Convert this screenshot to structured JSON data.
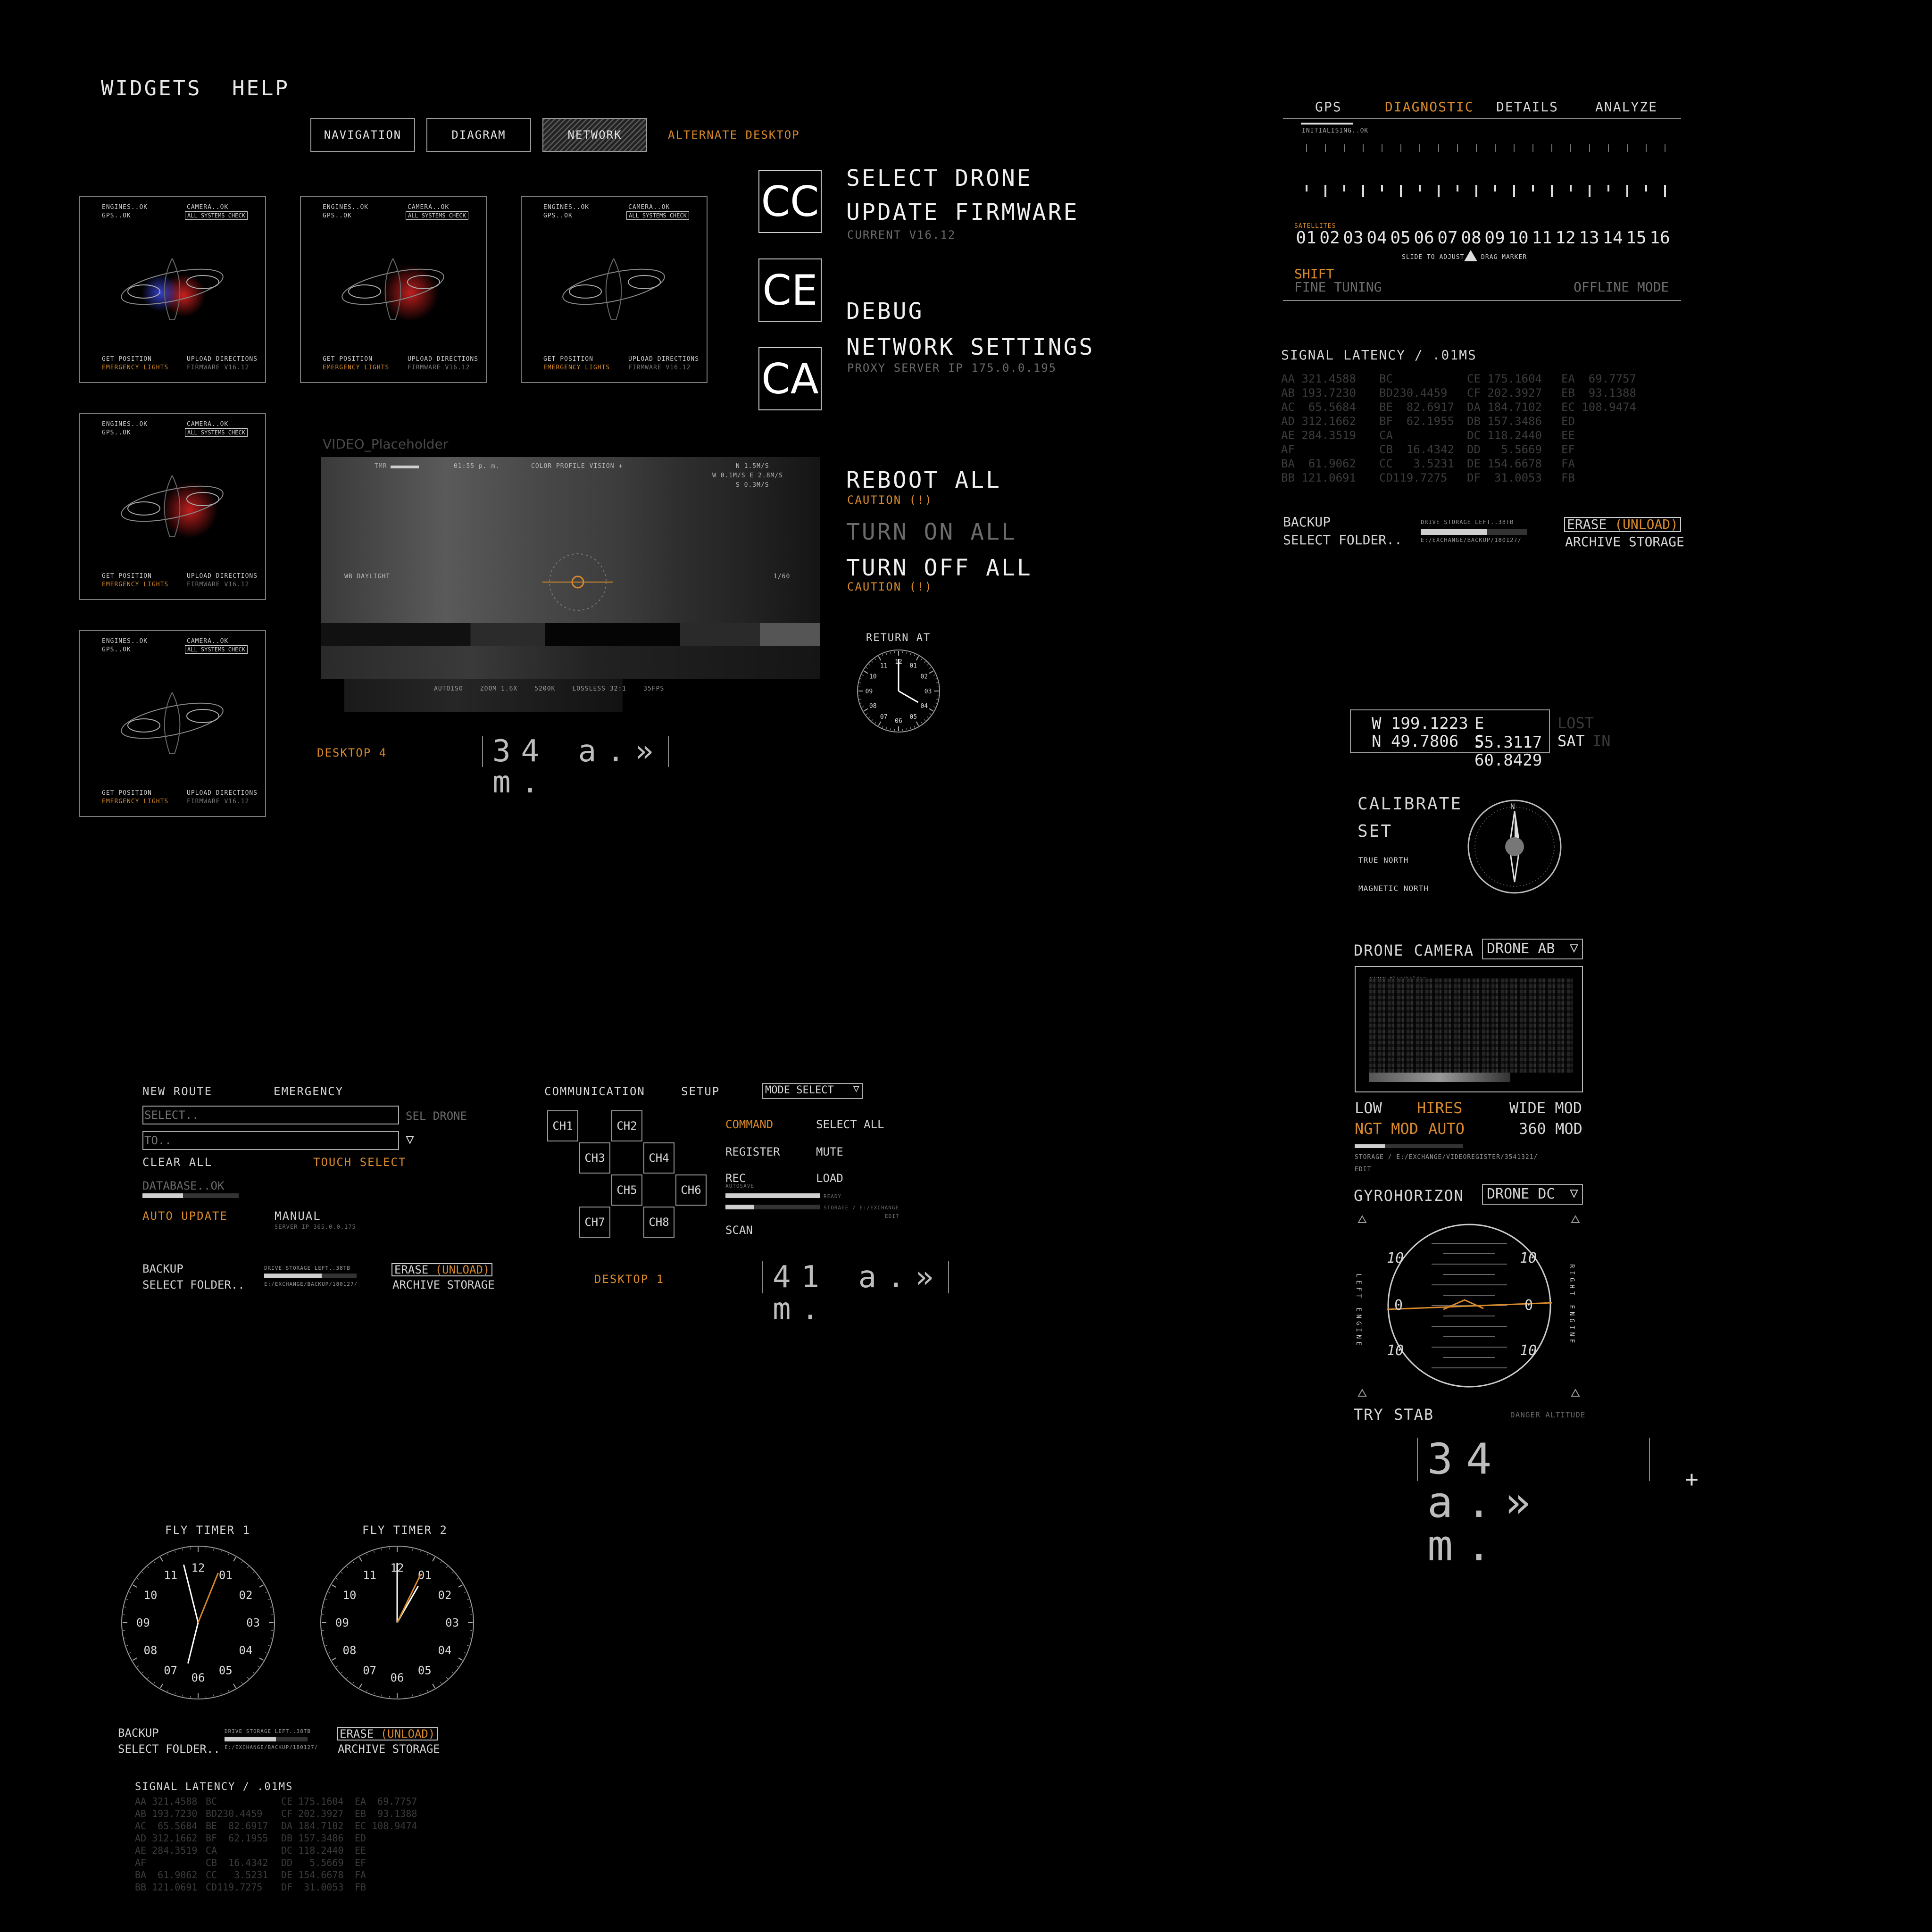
{
  "menu": {
    "widgets": "WIDGETS",
    "help": "HELP"
  },
  "tabs": [
    {
      "label": "NAVIGATION"
    },
    {
      "label": "DIAGRAM"
    },
    {
      "label": "NETWORK",
      "active": true
    }
  ],
  "alternate_desktop": "ALTERNATE DESKTOP",
  "drone_cards": [
    {
      "engines": "ENGINES..OK",
      "gps": "GPS..OK",
      "camera": "CAMERA..OK",
      "check": "ALL SYSTEMS CHECK",
      "get_position": "GET POSITION",
      "emergency": "EMERGENCY LIGHTS",
      "upload": "UPLOAD DIRECTIONS",
      "firmware": "FIRMWARE V16.12",
      "glow": "blue-red"
    },
    {
      "engines": "ENGINES..OK",
      "gps": "GPS..OK",
      "camera": "CAMERA..OK",
      "check": "ALL SYSTEMS CHECK",
      "get_position": "GET POSITION",
      "emergency": "EMERGENCY LIGHTS",
      "upload": "UPLOAD DIRECTIONS",
      "firmware": "FIRMWARE V16.12",
      "glow": "red"
    },
    {
      "engines": "ENGINES..OK",
      "gps": "GPS..OK",
      "camera": "CAMERA..OK",
      "check": "ALL SYSTEMS CHECK",
      "get_position": "GET POSITION",
      "emergency": "EMERGENCY LIGHTS",
      "upload": "UPLOAD DIRECTIONS",
      "firmware": "FIRMWARE V16.12",
      "glow": "none"
    },
    {
      "engines": "ENGINES..OK",
      "gps": "GPS..OK",
      "camera": "CAMERA..OK",
      "check": "ALL SYSTEMS CHECK",
      "get_position": "GET POSITION",
      "emergency": "EMERGENCY LIGHTS",
      "upload": "UPLOAD DIRECTIONS",
      "firmware": "FIRMWARE V16.12",
      "glow": "red"
    },
    {
      "engines": "ENGINES..OK",
      "gps": "GPS..OK",
      "camera": "CAMERA..OK",
      "check": "ALL SYSTEMS CHECK",
      "get_position": "GET POSITION",
      "emergency": "EMERGENCY LIGHTS",
      "upload": "UPLOAD DIRECTIONS",
      "firmware": "FIRMWARE V16.12",
      "glow": "none"
    }
  ],
  "actions": {
    "cc": "CC",
    "ce": "CE",
    "ca": "CA",
    "select_drone": "SELECT DRONE",
    "update_firmware": "UPDATE FIRMWARE",
    "current_version": "CURRENT V16.12",
    "debug": "DEBUG",
    "network_settings": "NETWORK SETTINGS",
    "proxy": "PROXY SERVER IP 175.0.0.195",
    "reboot_all": "REBOOT ALL",
    "caution": "CAUTION (!)",
    "turn_on_all": "TURN ON ALL",
    "turn_off_all": "TURN OFF ALL",
    "return_at": "RETURN AT"
  },
  "video": {
    "title": "VIDEO_Placeholder",
    "time": "01:55 p. m.",
    "profile": "COLOR PROFILE VISION +",
    "wind_n": "N 1.5M/S",
    "wind_we": "W 0.1M/S   E 2.8M/S",
    "wind_s": "S 0.3M/S",
    "wb": "WB DAYLIGHT",
    "shutter": "1/60",
    "footer": [
      "AUTOISO",
      "ZOOM 1.6X",
      "5200K",
      "LOSSLESS 32:1",
      "35FPS"
    ]
  },
  "desktop4": "DESKTOP 4",
  "time_display": "34 a.» m.",
  "time_display2": "41 a.» m.",
  "gps_panel": {
    "tabs": [
      "GPS",
      "DIAGNOSTIC",
      "DETAILS",
      "ANALYZE"
    ],
    "initialising": "INITIALISING..OK",
    "satellites_label": "SATELLITES",
    "satellites": [
      "01",
      "02",
      "03",
      "04",
      "05",
      "06",
      "07",
      "08",
      "09",
      "10",
      "11",
      "12",
      "13",
      "14",
      "15",
      "16"
    ],
    "slide_hint": "SLIDE TO ADJUST",
    "drag_hint": "DRAG MARKER",
    "shift": "SHIFT",
    "fine_tuning": "FINE TUNING",
    "offline_mode": "OFFLINE MODE"
  },
  "signal_latency": {
    "title": "SIGNAL LATENCY / .01MS",
    "columns": [
      [
        "AA 321.4588",
        "AB 193.7230",
        "AC  65.5684",
        "AD 312.1662",
        "AE 284.3519",
        "AF",
        "BA  61.9062",
        "BB 121.0691"
      ],
      [
        "BC",
        "BD230.4459",
        "BE  82.6917",
        "BF  62.1955",
        "CA",
        "CB  16.4342",
        "CC   3.5231",
        "CD119.7275"
      ],
      [
        "CE 175.1604",
        "CF 202.3927",
        "DA 184.7102",
        "DB 157.3486",
        "DC 118.2440",
        "DD   5.5669",
        "DE 154.6678",
        "DF  31.0053"
      ],
      [
        "EA  69.7757",
        "EB  93.1388",
        "EC 108.9474",
        "ED",
        "EE",
        "EF",
        "FA",
        "FB"
      ]
    ]
  },
  "storage": {
    "backup": "BACKUP",
    "select_folder": "SELECT FOLDER..",
    "drive_left": "DRIVE STORAGE LEFT..38TB",
    "path": "E:/EXCHANGE/BACKUP/180127/",
    "fill": 0.62,
    "erase": "ERASE",
    "unload": "(UNLOAD)",
    "archive": "ARCHIVE STORAGE"
  },
  "coords": {
    "w": "W 199.1223",
    "e": "E 55.3117",
    "n": "N 49.7806",
    "s": "S 60.8429",
    "lost": "LOST",
    "sat": "SAT",
    "in": "IN"
  },
  "compass": {
    "calibrate": "CALIBRATE",
    "set": "SET",
    "true_north": "TRUE NORTH",
    "magnetic_north": "MAGNETIC NORTH",
    "n": "N"
  },
  "drone_camera": {
    "title": "DRONE CAMERA",
    "select": "DRONE AB",
    "vid": "VIDEO Placeholder",
    "low": "LOW",
    "hires": "HIRES",
    "wide": "WIDE MOD",
    "ngt": "NGT MOD",
    "auto": "AUTO",
    "mod360": "360 MOD",
    "storage": "STORAGE / E:/EXCHANGE/VIDEOREGISTER/3541321/",
    "edit": "EDIT",
    "fill": 0.28
  },
  "gyro": {
    "title": "GYROHORIZON",
    "select": "DRONE DC",
    "left_engine": "LEFT ENGINE",
    "right_engine": "RIGHT ENGINE",
    "ten": "10",
    "zero": "0",
    "try_stab": "TRY STAB",
    "danger": "DANGER ALTITUDE"
  },
  "route": {
    "new_route": "NEW ROUTE",
    "emergency": "EMERGENCY",
    "select_placeholder": "SELECT..",
    "to_placeholder": "TO..",
    "sel_drone": "SEL DRONE",
    "clear_all": "CLEAR ALL",
    "touch_select": "TOUCH SELECT",
    "database": "DATABASE..OK",
    "db_sub": "42%",
    "auto_update": "AUTO UPDATE",
    "manual": "MANUAL",
    "server": "SERVER IP 365.0.0.175",
    "db_fill": 0.42
  },
  "comm": {
    "communication": "COMMUNICATION",
    "setup": "SETUP",
    "mode_select": "MODE SELECT",
    "channels": [
      "CH1",
      "CH2",
      "CH3",
      "CH4",
      "CH5",
      "CH6",
      "CH7",
      "CH8"
    ],
    "command": "COMMAND",
    "select_all": "SELECT ALL",
    "register": "REGISTER",
    "mute": "MUTE",
    "rec": "REC",
    "autosave": "AUTOSAVE",
    "load": "LOAD",
    "ready": "READY",
    "storage": "STORAGE / E:/EXCHANGE",
    "edit": "EDIT",
    "scan": "SCAN",
    "rec_fill": 1.0,
    "storage_fill": 0.3
  },
  "desktop1": "DESKTOP 1",
  "timers": {
    "t1": "FLY TIMER 1",
    "t2": "FLY TIMER 2",
    "nums": [
      "12",
      "01",
      "02",
      "03",
      "04",
      "05",
      "06",
      "07",
      "08",
      "09",
      "10",
      "11"
    ]
  }
}
